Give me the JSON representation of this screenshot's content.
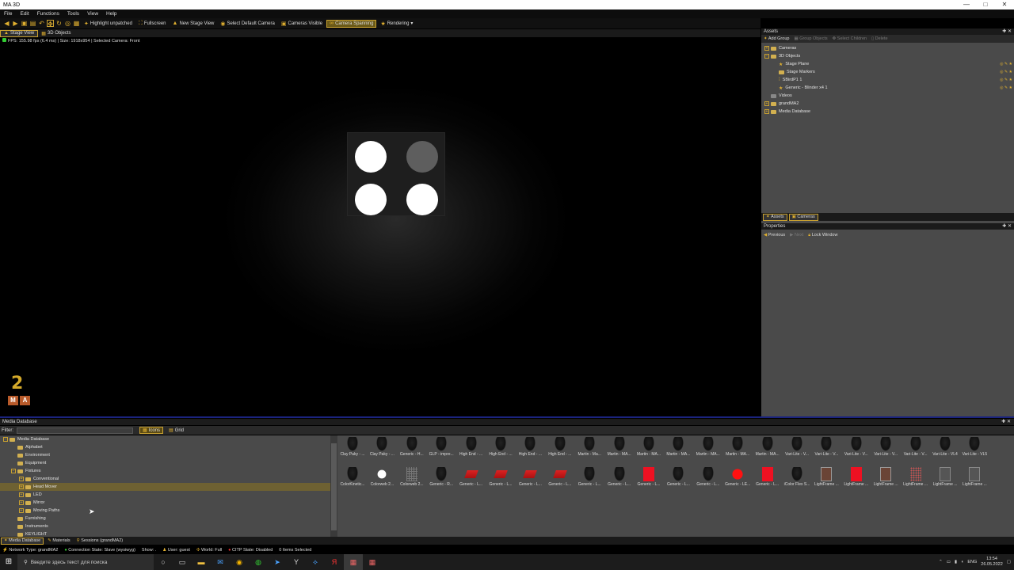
{
  "window": {
    "title": "MA 3D",
    "controls": [
      "—",
      "□",
      "✕"
    ]
  },
  "menu": [
    "File",
    "Edit",
    "Functions",
    "Tools",
    "View",
    "Help"
  ],
  "toolbar": {
    "buttons": [
      {
        "label": "Highlight unpatched",
        "icon": "highlight-icon"
      },
      {
        "label": "Fullscreen",
        "icon": "fullscreen-icon"
      },
      {
        "label": "New Stage View",
        "icon": "stage-view-icon"
      },
      {
        "label": "Select Default Camera",
        "icon": "camera-icon"
      },
      {
        "label": "Cameras Visible",
        "icon": "camera-visible-icon"
      },
      {
        "label": "Camera Spanning",
        "icon": "camera-spanning-icon"
      },
      {
        "label": "Rendering",
        "icon": "rendering-icon"
      }
    ]
  },
  "view_tabs": [
    "Stage View",
    "3D Objects"
  ],
  "viewport": {
    "fps_text": "FPS: 155.98 fps (6.4 ms) | Size: 1918x954 | Selected Camera: Front"
  },
  "logo": {
    "digit": "2",
    "letters": [
      "M",
      "A"
    ]
  },
  "assets": {
    "title": "Assets",
    "tools": [
      "Add Group",
      "Group Objects",
      "Select Children",
      "Delete"
    ],
    "tree": [
      {
        "label": "Cameras",
        "level": 0,
        "type": "folder"
      },
      {
        "label": "3D Objects",
        "level": 0,
        "type": "folder"
      },
      {
        "label": "Stage Plane",
        "level": 1,
        "type": "star"
      },
      {
        "label": "Stage Markers",
        "level": 1,
        "type": "folder"
      },
      {
        "label": "SBirdP1 1",
        "level": 1,
        "type": "fixture"
      },
      {
        "label": "Generic - Blinder x4 1",
        "level": 1,
        "type": "star"
      },
      {
        "label": "Videos",
        "level": 0,
        "type": "folder"
      },
      {
        "label": "grandMA2",
        "level": 0,
        "type": "folder"
      },
      {
        "label": "Media Database",
        "level": 0,
        "type": "folder"
      }
    ],
    "bottom_tabs": [
      "Assets",
      "Cameras"
    ]
  },
  "properties": {
    "title": "Properties",
    "tools": [
      "Previous",
      "Next",
      "Lock Window"
    ]
  },
  "media_database": {
    "title": "Media Database",
    "filter_label": "Filter:",
    "view_modes": [
      "Icons",
      "Grid"
    ],
    "tree": [
      {
        "label": "Media Database",
        "level": 0
      },
      {
        "label": "Alphabet",
        "level": 1
      },
      {
        "label": "Environment",
        "level": 1
      },
      {
        "label": "Equipment",
        "level": 1
      },
      {
        "label": "Fixtures",
        "level": 1
      },
      {
        "label": "Conventional",
        "level": 2
      },
      {
        "label": "Head Mover",
        "level": 2,
        "selected": true
      },
      {
        "label": "LED",
        "level": 2
      },
      {
        "label": "Mirror",
        "level": 2
      },
      {
        "label": "Moving Paths",
        "level": 2
      },
      {
        "label": "Furnishing",
        "level": 1
      },
      {
        "label": "Instruments",
        "level": 1
      },
      {
        "label": "KEYLIGHT",
        "level": 1
      }
    ],
    "items": [
      {
        "label": "Clay Paky - ...",
        "pic": "dark"
      },
      {
        "label": "Clay Paky - ...",
        "pic": "dark"
      },
      {
        "label": "Generic - H...",
        "pic": "dark"
      },
      {
        "label": "GLP - impre...",
        "pic": "dark"
      },
      {
        "label": "High End - ...",
        "pic": "dark"
      },
      {
        "label": "High End - ...",
        "pic": "dark"
      },
      {
        "label": "High End - ...",
        "pic": "dark"
      },
      {
        "label": "High End - ...",
        "pic": "dark"
      },
      {
        "label": "Martin - Ma...",
        "pic": "dark"
      },
      {
        "label": "Martin - MA...",
        "pic": "dark"
      },
      {
        "label": "Martin - MA...",
        "pic": "dark"
      },
      {
        "label": "Martin - MA...",
        "pic": "dark"
      },
      {
        "label": "Martin - MA...",
        "pic": "dark"
      },
      {
        "label": "Martin - MA...",
        "pic": "dark"
      },
      {
        "label": "Martin - MA...",
        "pic": "dark"
      },
      {
        "label": "Vari-Lite - V...",
        "pic": "dark"
      },
      {
        "label": "Vari-Lite - V...",
        "pic": "dark"
      },
      {
        "label": "Vari-Lite - V...",
        "pic": "dark"
      },
      {
        "label": "Vari-Lite - V...",
        "pic": "dark"
      },
      {
        "label": "Vari-Lite - V...",
        "pic": "dark"
      },
      {
        "label": "Vari-Lite - VL4",
        "pic": "dark"
      },
      {
        "label": "Vari-Lite - VL5",
        "pic": "dark"
      },
      {
        "label": "ColorKinetic...",
        "pic": "dark"
      },
      {
        "label": "Colorweb 2...",
        "pic": "white"
      },
      {
        "label": "Colorweb 2...",
        "pic": "grid"
      },
      {
        "label": "Generic - R...",
        "pic": "dark"
      },
      {
        "label": "Generic - L...",
        "pic": "red"
      },
      {
        "label": "Generic - L...",
        "pic": "red"
      },
      {
        "label": "Generic - L...",
        "pic": "red"
      },
      {
        "label": "Generic - L...",
        "pic": "red"
      },
      {
        "label": "Generic - L...",
        "pic": "dark"
      },
      {
        "label": "Generic - L...",
        "pic": "dark"
      },
      {
        "label": "Generic - L...",
        "pic": "redsq"
      },
      {
        "label": "Generic - L...",
        "pic": "dark"
      },
      {
        "label": "Generic - L...",
        "pic": "dark"
      },
      {
        "label": "Generic - LE...",
        "pic": "redc"
      },
      {
        "label": "Generic - L...",
        "pic": "redsq"
      },
      {
        "label": "iColor Flex S...",
        "pic": "dark"
      },
      {
        "label": "LightFrame ...",
        "pic": "frame"
      },
      {
        "label": "LightFrame ...",
        "pic": "redsq"
      },
      {
        "label": "LightFrame ...",
        "pic": "frame"
      },
      {
        "label": "LightFrame ...",
        "pic": "dots"
      },
      {
        "label": "LightFrame ...",
        "pic": "gray"
      },
      {
        "label": "LightFrame ...",
        "pic": "gray"
      }
    ]
  },
  "bottom_tabs": [
    "Media Database",
    "Materials",
    "Sessions (grandMA2)"
  ],
  "status": {
    "network": "Network Type: grandMA2",
    "connection": "Connection State: Slave (wysiwyg)",
    "show": "Show: .",
    "user": "User: guest",
    "world": "World: Full",
    "citp": "CITP State: Disabled",
    "selected": "0 Items Selected"
  },
  "taskbar": {
    "search_placeholder": "Введите здесь текст для поиска",
    "lang": "ENG",
    "time": "13:54",
    "date": "26.05.2022"
  },
  "colors": {
    "accent": "#c9a130",
    "panel": "#4a4a4a",
    "selected_row": "#6e6132"
  }
}
